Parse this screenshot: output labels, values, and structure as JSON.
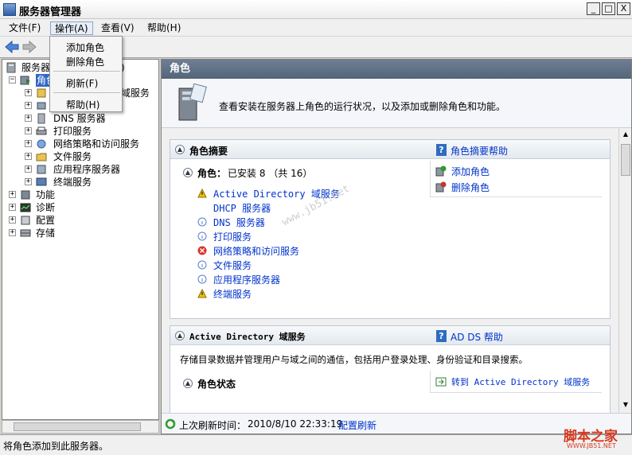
{
  "window": {
    "title": "服务器管理器",
    "minimize": "_",
    "maximize": "□",
    "close": "X"
  },
  "menubar": {
    "items": [
      "文件(F)",
      "操作(A)",
      "查看(V)",
      "帮助(H)"
    ]
  },
  "dropdown": {
    "items": [
      "添加角色",
      "删除角色",
      "刷新(F)",
      "帮助(H)"
    ]
  },
  "tree": {
    "root": "服务器",
    "root_suffix": ")",
    "roles": "角色",
    "ad_partial": "y 域服务",
    "children": [
      "DNS 服务器",
      "打印服务",
      "网络策略和访问服务",
      "文件服务",
      "应用程序服务器",
      "终端服务"
    ],
    "top_items": [
      "功能",
      "诊断",
      "配置",
      "存储"
    ]
  },
  "right": {
    "header": "角色",
    "intro": "查看安装在服务器上角色的运行状况，以及添加或删除角色和功能。",
    "summary": {
      "title": "角色摘要",
      "help_link": "角色摘要帮助",
      "roles_label": "角色：",
      "roles_count": "已安装 8 （共 16）",
      "add_role": "添加角色",
      "remove_role": "删除角色",
      "roles": [
        {
          "label": "Active Directory 域服务",
          "status": "warning"
        },
        {
          "label": "DHCP 服务器",
          "status": "none"
        },
        {
          "label": "DNS 服务器",
          "status": "info"
        },
        {
          "label": "打印服务",
          "status": "info"
        },
        {
          "label": "网络策略和访问服务",
          "status": "error"
        },
        {
          "label": "文件服务",
          "status": "info"
        },
        {
          "label": "应用程序服务器",
          "status": "info"
        },
        {
          "label": "终端服务",
          "status": "warning"
        }
      ]
    },
    "ad": {
      "title": "Active Directory 域服务",
      "help_link": "AD DS 帮助",
      "description": "存储目录数据并管理用户与域之间的通信，包括用户登录处理、身份验证和目录搜索。",
      "status_title": "角色状态",
      "goto_link": "转到 Active Directory 域服务"
    },
    "refresh": {
      "label": "上次刷新时间：",
      "time": "2010/8/10 22:33:19",
      "config_link": "配置刷新"
    }
  },
  "statusbar": {
    "text": "将角色添加到此服务器。"
  },
  "watermark": {
    "text": "www.jb51.net",
    "logo": "脚本之家",
    "logo_sub": "WWW.JB51.NET"
  },
  "colors": {
    "warning": "#f2c200",
    "info": "#5c7ec9",
    "error": "#d9352b",
    "link": "#0033cc"
  }
}
